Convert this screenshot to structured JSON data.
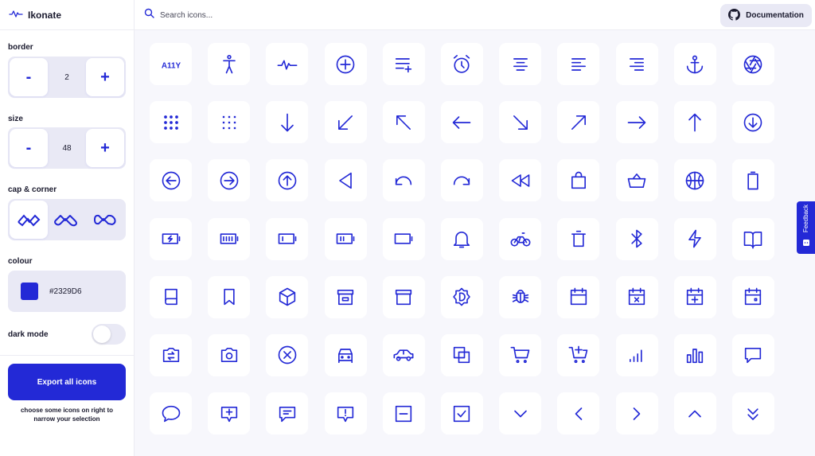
{
  "app": {
    "name": "Ikonate",
    "logo_icon": "pulse-icon"
  },
  "search": {
    "placeholder": "Search icons...",
    "value": ""
  },
  "header": {
    "doc_label": "Documentation",
    "doc_icon": "github-icon"
  },
  "sidebar": {
    "border": {
      "label": "border",
      "value": "2",
      "minus": "-",
      "plus": "+"
    },
    "size": {
      "label": "size",
      "value": "48",
      "minus": "-",
      "plus": "+"
    },
    "cap_corner": {
      "label": "cap & corner",
      "options": [
        "miter",
        "round",
        "square"
      ],
      "selected": 0
    },
    "colour": {
      "label": "colour",
      "value": "#2329D6"
    },
    "dark_mode": {
      "label": "dark mode",
      "enabled": false
    },
    "export": {
      "label": "Export all icons",
      "hint": "choose some icons on right to narrow your selection"
    }
  },
  "feedback": {
    "label": "Feedback"
  },
  "colors": {
    "accent": "#2329D6",
    "tile": "#ffffff",
    "background": "#f7f7fc"
  },
  "icons": [
    "a11y-icon",
    "accessibility-icon",
    "activity-icon",
    "add-icon",
    "add-to-list-icon",
    "alarm-icon",
    "align-center-icon",
    "align-left-icon",
    "align-right-icon",
    "anchor-icon",
    "aperture-icon",
    "apps-icon",
    "apps-alt-icon",
    "arrow-down-icon",
    "arrow-down-left-icon",
    "arrow-up-left-icon",
    "arrow-left-icon",
    "arrow-down-right-icon",
    "arrow-up-right-icon",
    "arrow-right-icon",
    "arrow-up-icon",
    "arrow-down-circle-icon",
    "arrow-left-circle-icon",
    "arrow-right-circle-icon",
    "arrow-up-circle-icon",
    "back-icon",
    "undo-icon",
    "redo-icon",
    "rewind-icon",
    "bag-icon",
    "basket-icon",
    "basketball-icon",
    "battery-icon",
    "battery-charging-icon",
    "battery-full-icon",
    "battery-low-icon",
    "battery-medium-icon",
    "battery-empty-icon",
    "bell-icon",
    "bike-icon",
    "bin-icon",
    "bluetooth-icon",
    "bolt-icon",
    "book-opened-icon",
    "book-icon",
    "bookmark-icon",
    "box-icon",
    "box-alt-icon",
    "archive-icon",
    "brightness-icon",
    "bug-icon",
    "calendar-icon",
    "calendar-remove-icon",
    "calendar-add-icon",
    "calendar-event-icon",
    "camera-switch-icon",
    "camera-icon",
    "cancel-icon",
    "car-front-icon",
    "car-side-icon",
    "copy-icon",
    "cart-icon",
    "cart-add-icon",
    "signal-icon",
    "bar-chart-icon",
    "chat-icon",
    "chat-bubble-icon",
    "chat-add-icon",
    "chat-lines-icon",
    "chat-error-icon",
    "checkbox-minus-icon",
    "checkbox-icon",
    "chevron-down-icon",
    "chevron-left-icon",
    "chevron-right-icon",
    "chevron-up-icon",
    "chevrons-down-icon"
  ]
}
